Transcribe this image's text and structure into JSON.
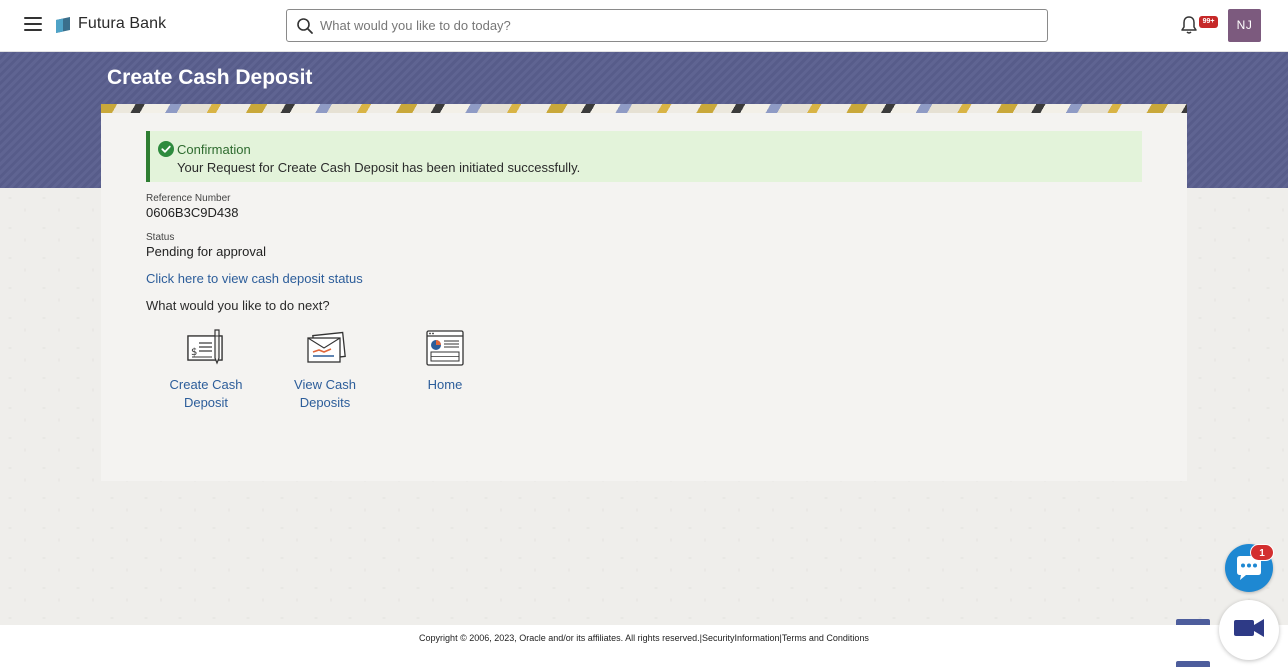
{
  "header": {
    "brand": "Futura Bank",
    "search_placeholder": "What would you like to do today?",
    "notification_badge": "99+",
    "avatar_initials": "NJ"
  },
  "page": {
    "title": "Create Cash Deposit"
  },
  "confirmation": {
    "title": "Confirmation",
    "message": "Your Request for Create Cash Deposit has been initiated successfully."
  },
  "details": {
    "reference_label": "Reference Number",
    "reference_value": "0606B3C9D438",
    "status_label": "Status",
    "status_value": "Pending for approval"
  },
  "status_link": "Click here to view cash deposit status",
  "next_prompt": "What would you like to do next?",
  "actions": [
    {
      "line1": "Create Cash",
      "line2": "Deposit",
      "icon": "cheque-icon"
    },
    {
      "line1": "View Cash",
      "line2": "Deposits",
      "icon": "envelope-cards-icon"
    },
    {
      "line1": "Home",
      "line2": "",
      "icon": "dashboard-icon"
    }
  ],
  "footer": {
    "copyright": "Copyright © 2006, 2023, Oracle and/or its affiliates. All rights reserved.",
    "security": "SecurityInformation",
    "terms": "Terms and Conditions"
  },
  "chat": {
    "badge": "1"
  },
  "colors": {
    "banner": "#5a5f8e",
    "link": "#2c5d9a",
    "success_bg": "#e3f3da",
    "success_border": "#2e7d32",
    "avatar": "#7c5a7e",
    "chat": "#1e88d2"
  }
}
